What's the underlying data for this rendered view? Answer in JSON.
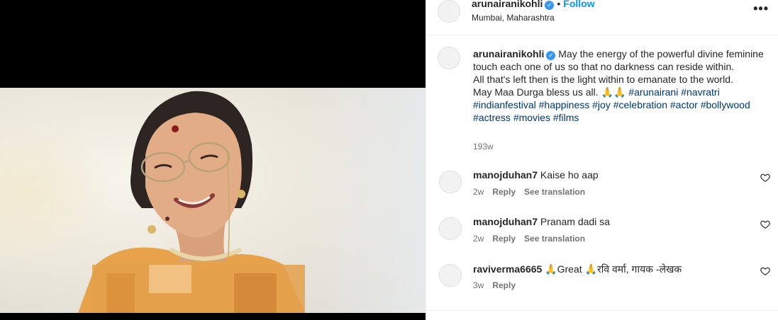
{
  "header": {
    "username": "arunairanikohli",
    "dot": "•",
    "follow_label": "Follow",
    "location": "Mumbai, Maharashtra",
    "more_icon": "more-horizontal-icon"
  },
  "caption": {
    "username": "arunairanikohli",
    "line1": "May the energy of the powerful divine feminine touch each one of us so that no darkness can reside within.",
    "line2": "All that's left then is the light within to emanate to the world.",
    "line3": "May Maa Durga bless us all. 🙏🙏",
    "hashtags": [
      "#arunairani",
      "#navratri",
      "#indianfestival",
      "#happiness",
      "#joy",
      "#celebration",
      "#actor",
      "#bollywood",
      "#actress",
      "#movies",
      "#films"
    ],
    "time": "193w"
  },
  "comments": [
    {
      "username": "manojduhan7",
      "text": "Kaise ho aap",
      "time": "2w",
      "reply": "Reply",
      "translate": "See translation"
    },
    {
      "username": "manojduhan7",
      "text": "Pranam dadi sa",
      "time": "2w",
      "reply": "Reply",
      "translate": "See translation"
    },
    {
      "username": "raviverma6665",
      "text": "🙏Great 🙏रवि वर्मा, गायक -लेखक",
      "time": "3w",
      "reply": "Reply"
    }
  ],
  "colors": {
    "link_blue": "#0095f6",
    "hashtag_blue": "#00376b",
    "verified_blue": "#3897f0",
    "meta_gray": "#737373"
  }
}
